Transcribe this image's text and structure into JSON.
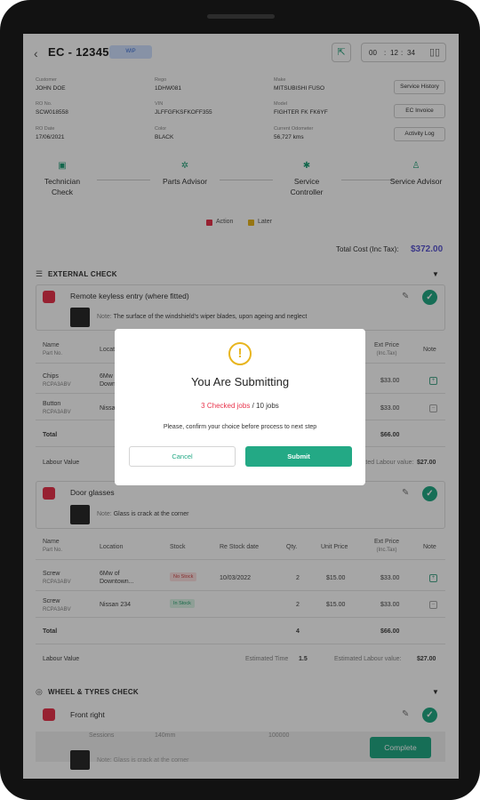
{
  "header": {
    "title": "EC - 12345",
    "badge": "WIP",
    "timer": {
      "hh": "00",
      "mm": "12",
      "ss": "34"
    }
  },
  "info": {
    "customer_label": "Customer",
    "customer": "JOHN DOE",
    "rego_label": "Rego",
    "rego": "1DHW081",
    "make_label": "Make",
    "make": "MITSUBISHI FUSO",
    "ro_label": "RO No.",
    "ro": "SCW018558",
    "vin_label": "VIN",
    "vin": "JLFFGFKSFKOFF355",
    "model_label": "Model",
    "model": "FIGHTER FK FK6YF",
    "ro_date_label": "RO Date",
    "ro_date": "17/06/2021",
    "color_label": "Color",
    "color": "BLACK",
    "odo_label": "Current Odometer",
    "odo": "56,727 kms",
    "buttons": [
      "Service History",
      "EC Invoice",
      "Activity Log"
    ]
  },
  "steps": [
    {
      "icon": "lock-icon",
      "label": "Technician Check"
    },
    {
      "icon": "gear-icon",
      "label": "Parts Advisor"
    },
    {
      "icon": "wand-icon",
      "label": "Service Controller"
    },
    {
      "icon": "person-icon",
      "label": "Service Advisor"
    }
  ],
  "legend": {
    "action": "Action",
    "later": "Later",
    "action_color": "#e8344c",
    "later_color": "#e8b51e"
  },
  "total_cost": {
    "label": "Total Cost (Inc Tax):",
    "value": "$372.00"
  },
  "sections": {
    "external": "EXTERNAL CHECK",
    "wheels": "WHEEL & TYRES CHECK"
  },
  "table_headers": {
    "name": "Name",
    "part_no": "Part No.",
    "location": "Location",
    "stock": "Stock",
    "re_stock": "Re Stock date",
    "qty": "Qty.",
    "unit_price": "Unit Price",
    "ext_price": "Ext Price",
    "inc_tax": "(Inc.Tax)",
    "note": "Note"
  },
  "job1": {
    "title": "Remote keyless entry (where fitted)",
    "note_label": "Note:",
    "note": "The surface of the windshield's wiper blades, upon ageing and neglect",
    "rows": [
      {
        "name": "Chips",
        "part": "RCPA3ABV",
        "location": "6Mw of",
        "location2": "Down...",
        "ext": "$33.00"
      },
      {
        "name": "Button",
        "part": "RCPA3ABV",
        "location": "Nissa",
        "location2": "",
        "ext": "$33.00"
      }
    ],
    "total_label": "Total",
    "total": "$66.00",
    "labour_label": "Labour Value",
    "est_labour_label": "Estimated Labour value:",
    "est_labour": "$27.00"
  },
  "job2": {
    "title": "Door glasses",
    "note_label": "Note:",
    "note": "Glass is crack at the corner",
    "rows": [
      {
        "name": "Screw",
        "part": "RCPA3ABV",
        "location": "6Mw of",
        "location2": "Downtown...",
        "stock": "No Stock",
        "re_stock": "10/03/2022",
        "qty": "2",
        "unit": "$15.00",
        "ext": "$33.00"
      },
      {
        "name": "Screw",
        "part": "RCPA3ABV",
        "location": "Nissan 234",
        "location2": "",
        "stock": "In Stock",
        "re_stock": "",
        "qty": "2",
        "unit": "$15.00",
        "ext": "$33.00"
      }
    ],
    "total_label": "Total",
    "total_qty": "4",
    "total": "$66.00",
    "labour_label": "Labour Value",
    "est_time_label": "Estimated Time",
    "est_time": "1.5",
    "est_labour_label": "Estimated Labour value:",
    "est_labour": "$27.00"
  },
  "job3": {
    "title": "Front right",
    "bottom_cols": [
      "Sessions",
      "140mm",
      "100000"
    ],
    "note": "Note: Glass is crack at the corner"
  },
  "complete_label": "Complete",
  "modal": {
    "title": "You Are Submitting",
    "checked": "3 Checked jobs",
    "total_jobs": "/ 10 jobs",
    "message": "Please, confirm your choice before process to next step",
    "cancel": "Cancel",
    "submit": "Submit"
  }
}
